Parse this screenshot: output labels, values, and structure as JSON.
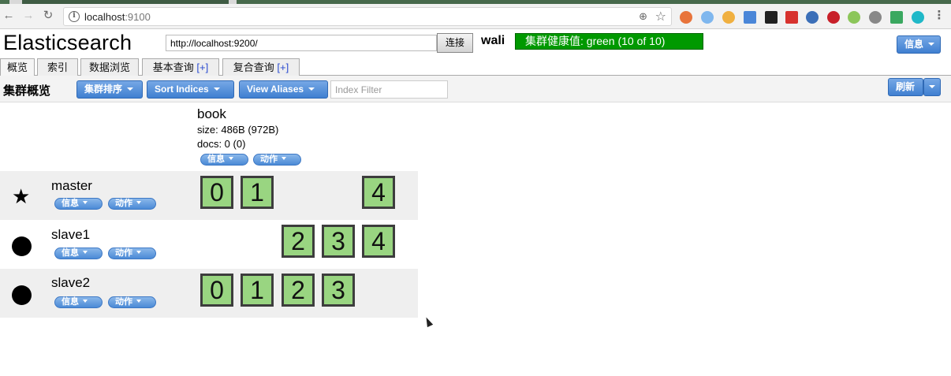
{
  "browser": {
    "url_host": "localhost",
    "url_port": ":9100"
  },
  "header": {
    "title": "Elasticsearch",
    "connect_url": "http://localhost:9200/",
    "connect_label": "连接",
    "cluster_name": "wali",
    "health": "集群健康值: green (10 of 10)",
    "health_color": "#009900",
    "info_label": "信息"
  },
  "tabs": [
    {
      "label": "概览",
      "plus": ""
    },
    {
      "label": "索引",
      "plus": ""
    },
    {
      "label": "数据浏览",
      "plus": ""
    },
    {
      "label": "基本查询",
      "plus": "[+]"
    },
    {
      "label": "复合查询",
      "plus": "[+]"
    }
  ],
  "toolbar": {
    "section_title": "集群概览",
    "sort_cluster": "集群排序",
    "sort_indices": "Sort Indices",
    "view_aliases": "View Aliases",
    "index_filter_placeholder": "Index Filter",
    "refresh": "刷新"
  },
  "index": {
    "name": "book",
    "size": "size: 486B (972B)",
    "docs": "docs: 0 (0)",
    "info_label": "信息",
    "action_label": "动作"
  },
  "nodes": [
    {
      "name": "master",
      "icon": "star-icon",
      "info_label": "信息",
      "action_label": "动作",
      "shards": [
        "0",
        "1",
        "",
        "",
        "4"
      ]
    },
    {
      "name": "slave1",
      "icon": "circle-icon",
      "info_label": "信息",
      "action_label": "动作",
      "shards": [
        "",
        "",
        "2",
        "3",
        "4"
      ]
    },
    {
      "name": "slave2",
      "icon": "circle-icon",
      "info_label": "信息",
      "action_label": "动作",
      "shards": [
        "0",
        "1",
        "2",
        "3",
        ""
      ]
    }
  ],
  "colors": {
    "shard_fill": "#99d581",
    "button_blue": "#3f7fd1"
  }
}
